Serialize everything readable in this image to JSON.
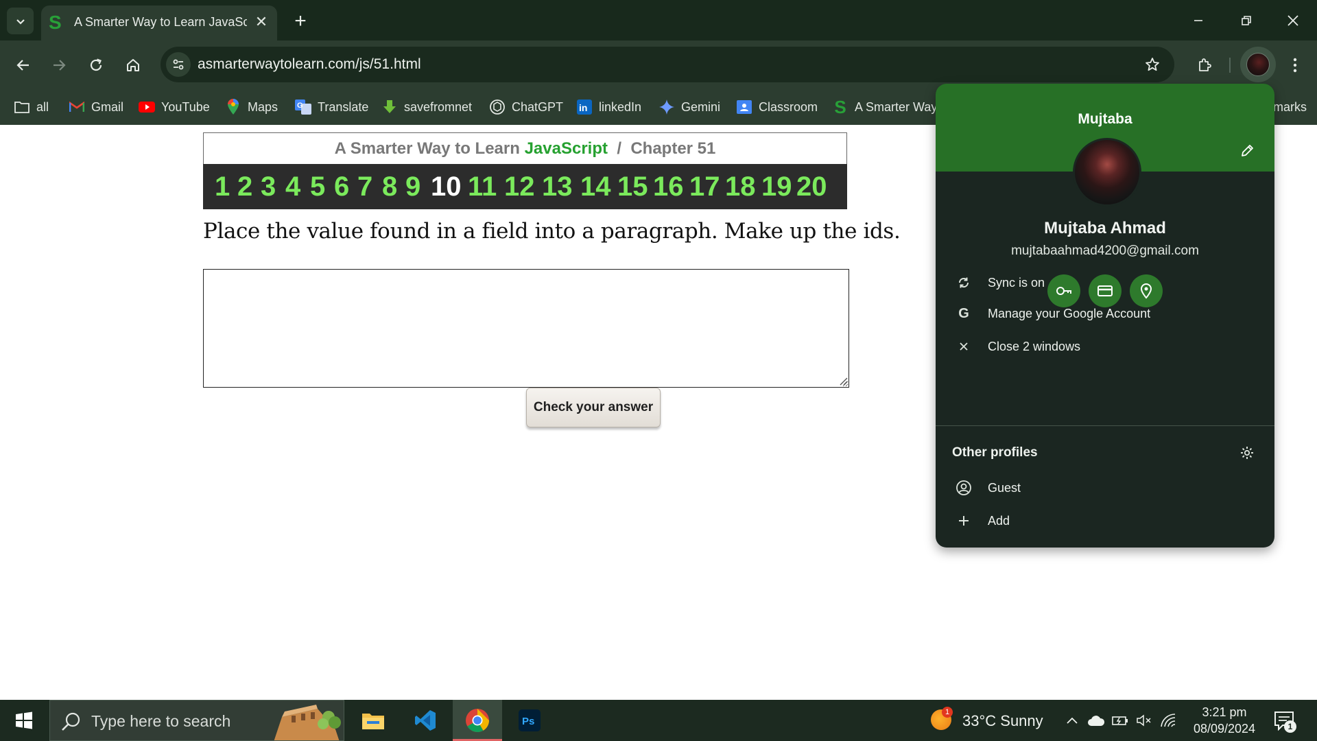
{
  "browser": {
    "tab": {
      "title": "A Smarter Way to Learn JavaScript",
      "favicon_letter": "S",
      "close": "✕"
    },
    "new_tab": "+",
    "url": "asmarterwaytolearn.com/js/51.html",
    "bookmarks": [
      {
        "label": "all",
        "icon": "folder-icon"
      },
      {
        "label": "Gmail",
        "icon": "gmail-icon"
      },
      {
        "label": "YouTube",
        "icon": "youtube-icon"
      },
      {
        "label": "Maps",
        "icon": "maps-icon"
      },
      {
        "label": "Translate",
        "icon": "translate-icon"
      },
      {
        "label": "savefromnet",
        "icon": "download-icon"
      },
      {
        "label": "ChatGPT",
        "icon": "chatgpt-icon"
      },
      {
        "label": "linkedIn",
        "icon": "linkedin-icon"
      },
      {
        "label": "Gemini",
        "icon": "gemini-icon"
      },
      {
        "label": "Classroom",
        "icon": "classroom-icon"
      },
      {
        "label": "A Smarter Way",
        "icon": "smarterway-icon"
      }
    ],
    "bookmarks_overflow": "marks",
    "colors": {
      "tabstrip": "#18291c",
      "toolbar": "#2c3d30",
      "accent": "#277026"
    }
  },
  "page": {
    "banner": {
      "prefix": "A Smarter Way to Learn ",
      "highlight": "JavaScript",
      "suffix": "  /  Chapter 51"
    },
    "chapters": [
      "1",
      "2",
      "3",
      "4",
      "5",
      "6",
      "7",
      "8",
      "9",
      "10",
      "11",
      "12",
      "13",
      "14",
      "15",
      "16",
      "17",
      "18",
      "19",
      "20"
    ],
    "current_chapter": "10",
    "instruction": "Place the value found in a field into a paragraph. Make up the ids.",
    "answer_value": "",
    "check_button": "Check your answer"
  },
  "profile_panel": {
    "header_name": "Mujtaba",
    "full_name": "Mujtaba Ahmad",
    "email": "mujtabaahmad4200@gmail.com",
    "quick_actions": [
      "key-icon",
      "card-icon",
      "location-icon"
    ],
    "items": [
      {
        "label": "Sync is on",
        "icon": "sync-icon"
      },
      {
        "label": "Manage your Google Account",
        "icon": "google-icon"
      },
      {
        "label": "Close 2 windows",
        "icon": "close-icon"
      }
    ],
    "other_profiles_title": "Other profiles",
    "profiles": [
      {
        "label": "Guest",
        "icon": "guest-icon"
      },
      {
        "label": "Add",
        "icon": "add-icon"
      }
    ]
  },
  "taskbar": {
    "search_placeholder": "Type here to search",
    "weather": "33°C  Sunny",
    "weather_badge": "1",
    "time": "3:21 pm",
    "date": "08/09/2024",
    "notification_count": "1"
  }
}
